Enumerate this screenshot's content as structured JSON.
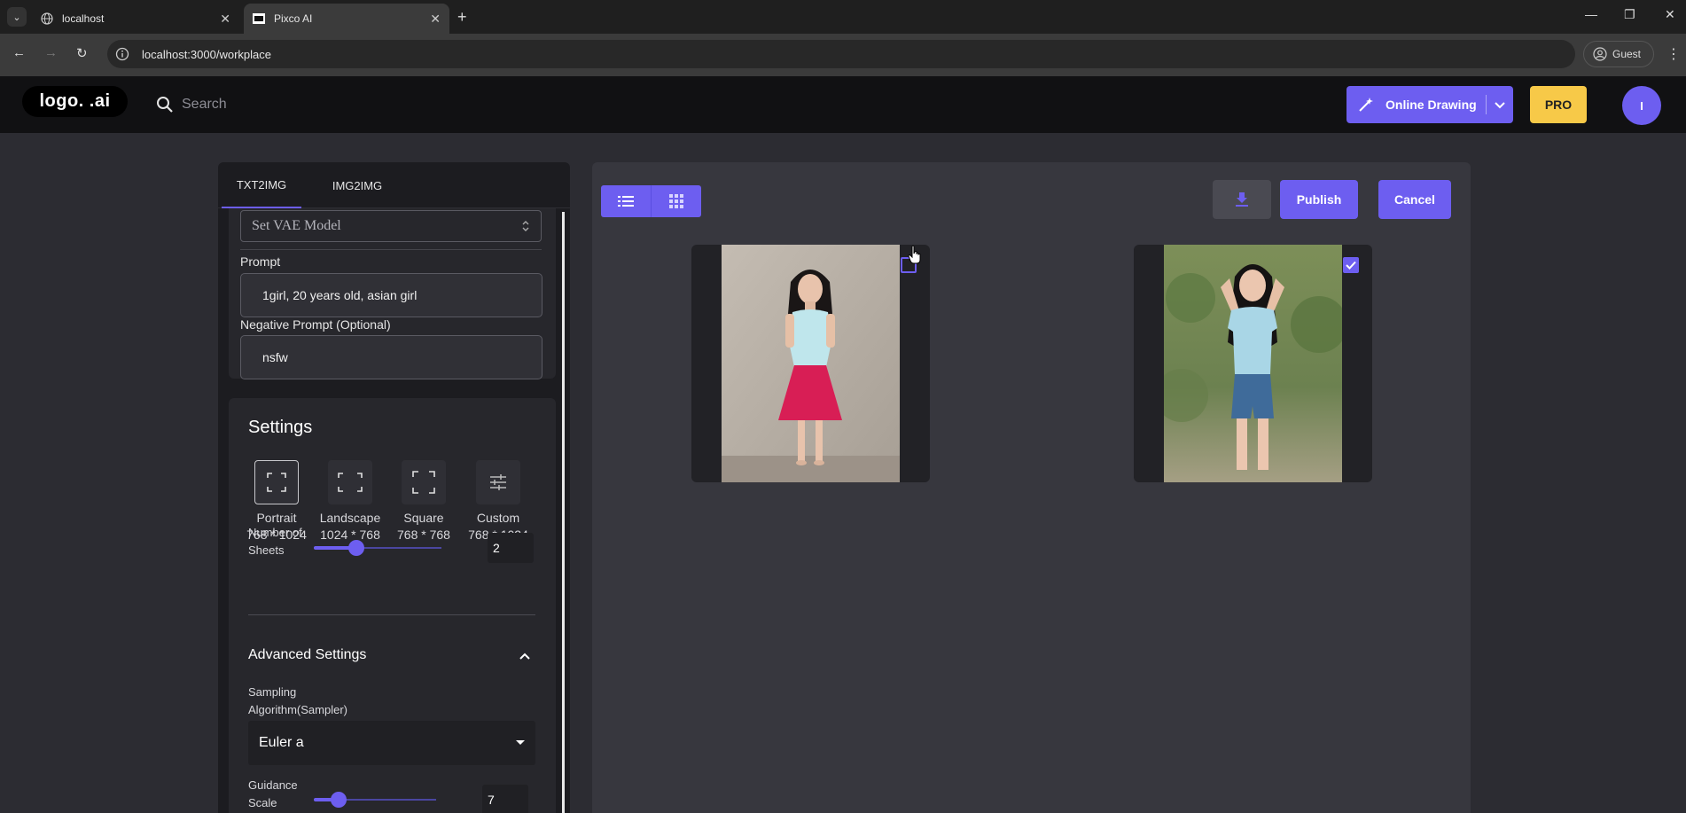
{
  "browser": {
    "tabs": [
      {
        "title": "localhost",
        "icon": "globe-icon"
      },
      {
        "title": "Pixco AI",
        "icon": "pixco-favicon"
      }
    ],
    "url": "localhost:3000/workplace",
    "profile_label": "Guest"
  },
  "header": {
    "logo_text": "logo. .ai",
    "search_placeholder": "Search",
    "online_drawing_label": "Online Drawing",
    "pro_label": "PRO",
    "avatar_initial": "I"
  },
  "left_panel": {
    "tabs": [
      {
        "label": "TXT2IMG",
        "active": true
      },
      {
        "label": "IMG2IMG",
        "active": false
      }
    ],
    "vae_select": "Set VAE Model",
    "prompt_label": "Prompt",
    "prompt_value": "1girl, 20 years old, asian girl",
    "negative_label": "Negative Prompt (Optional)",
    "negative_value": "nsfw",
    "settings": {
      "title": "Settings",
      "ratios": [
        {
          "name": "Portrait",
          "size": "768 * 1024",
          "selected": true,
          "icon": "portrait-frame-icon"
        },
        {
          "name": "Landscape",
          "size": "1024 * 768",
          "selected": false,
          "icon": "landscape-frame-icon"
        },
        {
          "name": "Square",
          "size": "768 * 768",
          "selected": false,
          "icon": "square-frame-icon"
        },
        {
          "name": "Custom",
          "size": "768 * 1024",
          "selected": false,
          "icon": "sliders-icon"
        }
      ],
      "sheets_label_1": "Number of",
      "sheets_label_2": "Sheets",
      "sheets_value": "2",
      "advanced_title": "Advanced Settings",
      "sampler_label_1": "Sampling",
      "sampler_label_2": "Algorithm(Sampler)",
      "sampler_value": "Euler a",
      "guidance_label_1": "Guidance",
      "guidance_label_2": "Scale",
      "guidance_value": "7"
    }
  },
  "right_panel": {
    "publish_label": "Publish",
    "cancel_label": "Cancel",
    "images": [
      {
        "checked": false,
        "description": "generated-image-1"
      },
      {
        "checked": true,
        "description": "generated-image-2"
      }
    ]
  },
  "colors": {
    "accent": "#6d5ef0",
    "pro": "#f7c948",
    "background": "#2c2c32"
  }
}
